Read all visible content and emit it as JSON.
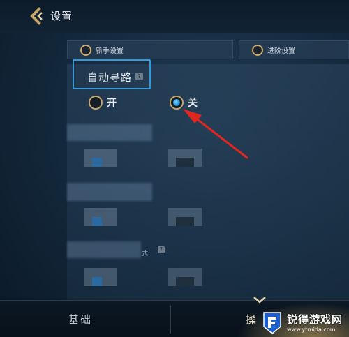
{
  "header": {
    "title": "设置"
  },
  "tabs": [
    {
      "label": "新手设置"
    },
    {
      "label": "进阶设置"
    }
  ],
  "setting": {
    "title": "自动寻路",
    "help": "?",
    "options": [
      {
        "label": "开",
        "selected": false
      },
      {
        "label": "关",
        "selected": true
      }
    ]
  },
  "blurred": {
    "partial_text": "式",
    "help": "?"
  },
  "bottom_nav": {
    "basic": "基础",
    "ops": "操"
  },
  "colors": {
    "highlight_box": "#2e9be0",
    "arrow": "#e0261e",
    "radio_ring": "#c2a36a",
    "accent": "#e6be6e"
  },
  "watermark": {
    "name": "锐得游戏网",
    "url": "www.ytruida.com"
  }
}
